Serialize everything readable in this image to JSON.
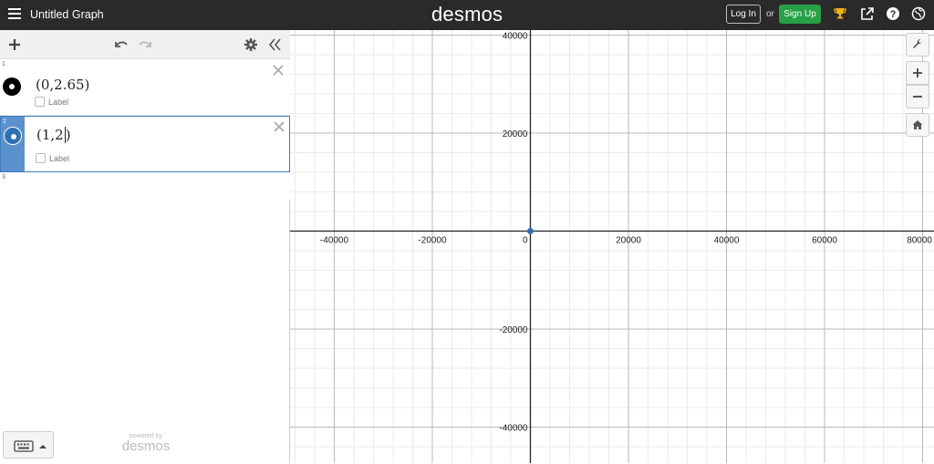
{
  "header": {
    "graph_title": "Untitled Graph",
    "logo": "desmos",
    "login_label": "Log In",
    "or_text": "or",
    "signup_label": "Sign Up",
    "icons": [
      "menu-icon",
      "trophy-icon",
      "share-icon",
      "help-icon",
      "globe-icon"
    ]
  },
  "toolbar": {
    "icons": [
      "add-icon",
      "undo-icon",
      "redo-icon",
      "settings-icon",
      "collapse-icon"
    ]
  },
  "expressions": [
    {
      "index": "1",
      "formula": "(0,2.65)",
      "label_text": "Label",
      "active": false
    },
    {
      "index": "2",
      "formula": "(1,2",
      "label_text": "Label",
      "active": true
    },
    {
      "index": "3"
    }
  ],
  "footer": {
    "powered_by": "powered by",
    "brand": "desmos",
    "keyboard_icon": "keyboard-icon"
  },
  "graph": {
    "x_ticks": [
      "-40000",
      "-20000",
      "0",
      "20000",
      "40000",
      "60000",
      "80000"
    ],
    "y_ticks": [
      "40000",
      "20000",
      "-20000",
      "-40000"
    ],
    "point_color": "#2d70b3",
    "accent_color": "#27a046"
  },
  "graph_controls": {
    "icons": [
      "wrench-icon",
      "zoom-in-icon",
      "zoom-out-icon",
      "home-icon"
    ]
  }
}
